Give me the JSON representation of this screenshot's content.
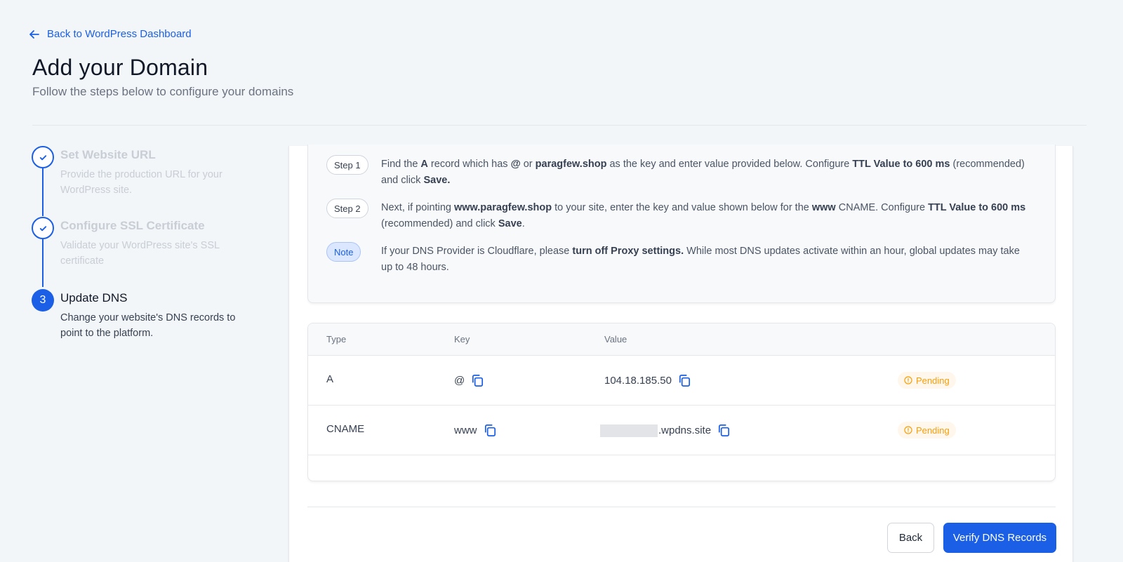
{
  "back_link": {
    "label": "Back to WordPress Dashboard",
    "icon": "arrow-left-icon"
  },
  "header": {
    "title": "Add your Domain",
    "subtitle": "Follow the steps below to configure your domains"
  },
  "stepper": {
    "steps": [
      {
        "status": "complete",
        "title": "Set Website URL",
        "description": "Provide the production URL for your WordPress site."
      },
      {
        "status": "complete",
        "title": "Configure SSL Certificate",
        "description": "Validate your WordPress site's SSL certificate"
      },
      {
        "status": "active",
        "number": "3",
        "title": "Update DNS",
        "description": "Change your website's DNS records to point to the platform."
      }
    ]
  },
  "instructions": {
    "step1": {
      "badge": "Step 1"
    },
    "step2": {
      "badge": "Step 2"
    },
    "note": {
      "badge": "Note"
    }
  },
  "dns_table": {
    "headers": {
      "type": "Type",
      "key": "Key",
      "value": "Value"
    },
    "rows": [
      {
        "type": "A",
        "key": "@",
        "value": "104.18.185.50",
        "status": "Pending"
      },
      {
        "type": "CNAME",
        "key": "www",
        "value": ".wpdns.site",
        "status": "Pending"
      }
    ]
  },
  "footer": {
    "back_label": "Back",
    "verify_label": "Verify DNS Records"
  },
  "colors": {
    "accent": "#1a5fe6",
    "pending": "#f59e0b",
    "background": "#f2f6f9"
  }
}
